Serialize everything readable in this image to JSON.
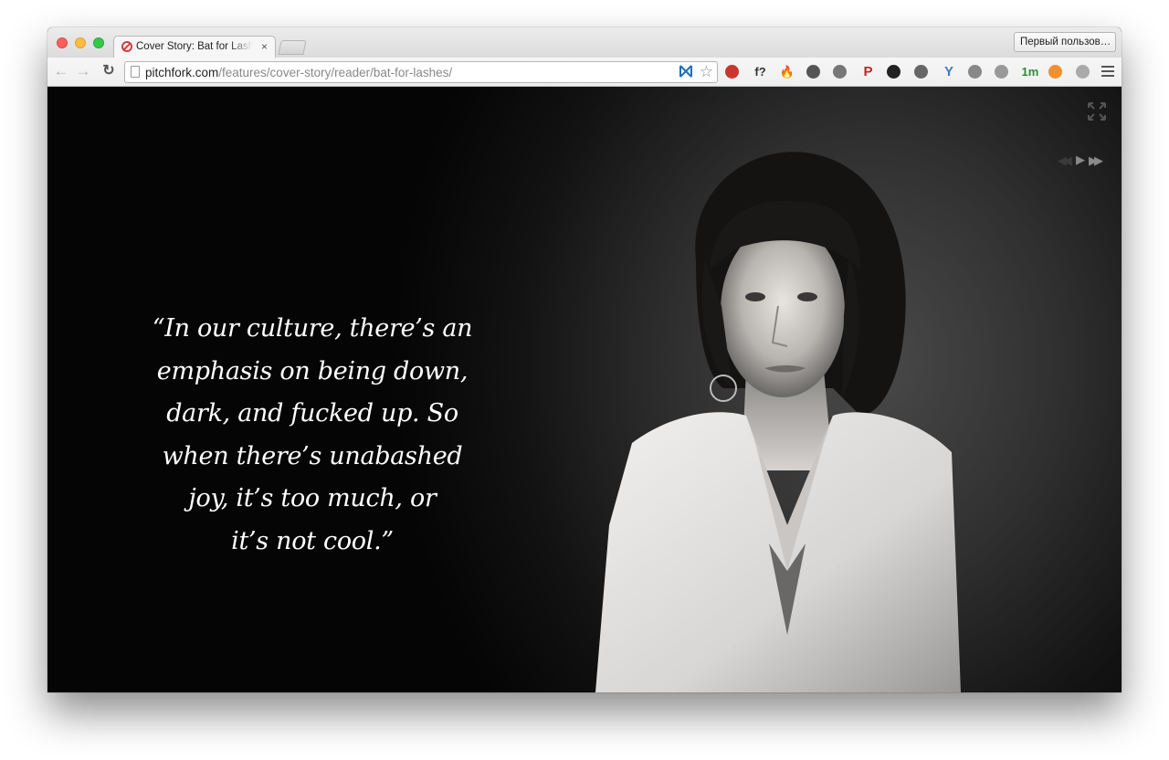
{
  "browser": {
    "tab": {
      "title": "Cover Story: Bat for Lashes",
      "close": "×"
    },
    "profile_button": "Первый пользов…",
    "url_host": "pitchfork.com",
    "url_path": "/features/cover-story/reader/bat-for-lashes/",
    "extensions": [
      {
        "name": "adblock-icon",
        "glyph": "",
        "color": "#c8362f"
      },
      {
        "name": "font-icon",
        "glyph": "f?",
        "color": "#333333"
      },
      {
        "name": "fire-icon",
        "glyph": "🔥",
        "color": "#e8712b"
      },
      {
        "name": "evernote-icon",
        "glyph": "",
        "color": "#555555"
      },
      {
        "name": "pocket-icon",
        "glyph": "",
        "color": "#777777"
      },
      {
        "name": "pinterest-icon",
        "glyph": "P",
        "color": "#cb2027"
      },
      {
        "name": "camera-icon",
        "glyph": "",
        "color": "#222222"
      },
      {
        "name": "eyedropper-icon",
        "glyph": "",
        "color": "#666666"
      },
      {
        "name": "yandex-icon",
        "glyph": "Y",
        "color": "#3a7bd5"
      },
      {
        "name": "sync-icon",
        "glyph": "",
        "color": "#888888"
      },
      {
        "name": "reader-icon",
        "glyph": "",
        "color": "#999999"
      },
      {
        "name": "timer-icon",
        "glyph": "1m",
        "color": "#2e8b3a"
      },
      {
        "name": "analytics-icon",
        "glyph": "",
        "color": "#f0912f"
      },
      {
        "name": "paw-icon",
        "glyph": "",
        "color": "#aaaaaa"
      }
    ]
  },
  "quote": {
    "lines": [
      "“In our culture, there’s an",
      "emphasis on being down,",
      "dark, and fucked up. So",
      "when there’s unabashed",
      "joy, it’s too much, or",
      "it’s not cool.”"
    ]
  },
  "controls": {
    "expand": "expand-icon",
    "prev": "rewind-icon",
    "play": "play-icon",
    "next": "fast-forward-icon"
  }
}
